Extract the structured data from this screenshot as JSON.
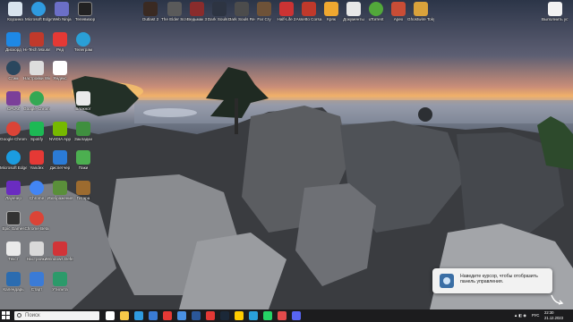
{
  "desktop": {
    "top_row": [
      {
        "label": "Корзина",
        "icon": "recycle-bin-icon",
        "color": "#d9e4ee"
      },
      {
        "label": "Microsoft Edge",
        "icon": "edge-icon",
        "color": "#2f9be0"
      },
      {
        "label": "Web Ninja",
        "icon": "app-icon",
        "color": "#6b6fc7"
      },
      {
        "label": "Телевизор",
        "icon": "tv-icon",
        "color": "#222222"
      }
    ],
    "games_row": [
      {
        "label": "Outlast 2",
        "icon": "game-icon",
        "color": "#3a2a22"
      },
      {
        "label": "The Elder Scrolls",
        "icon": "game-icon",
        "color": "#5a5a5a"
      },
      {
        "label": "Ведьмак 3",
        "icon": "game-icon",
        "color": "#8a2c2c"
      },
      {
        "label": "Dark Souls 3",
        "icon": "game-icon",
        "color": "#2d3442"
      },
      {
        "label": "Dark Souls Remaster",
        "icon": "game-icon",
        "color": "#4c4c4c"
      },
      {
        "label": "Far Cry",
        "icon": "game-icon",
        "color": "#6e5238"
      },
      {
        "label": "Half-Life 2",
        "icon": "game-icon",
        "color": "#cc3333"
      },
      {
        "label": "Assetto Corsa",
        "icon": "game-icon",
        "color": "#c0392b"
      },
      {
        "label": "Кряк",
        "icon": "app-icon",
        "color": "#f0a830"
      },
      {
        "label": "Документы",
        "icon": "document-icon",
        "color": "#e8e8e8"
      },
      {
        "label": "uTorrent",
        "icon": "torrent-icon",
        "color": "#52a83a"
      },
      {
        "label": "Apex",
        "icon": "game-icon",
        "color": "#c94d36"
      },
      {
        "label": "Ghostwire Tokyo",
        "icon": "game-icon",
        "color": "#d9a23b"
      }
    ],
    "right_icon": {
      "label": "Выполнить установку",
      "icon": "document-icon",
      "color": "#f2f2f2"
    },
    "left_column": [
      {
        "label": "Дискорд",
        "icon": "app-icon",
        "color": "#1e88e5"
      },
      {
        "label": "Стим",
        "icon": "steam-icon",
        "color": "#2a475e"
      },
      {
        "label": "CPU-Z",
        "icon": "app-icon",
        "color": "#7b3f99"
      },
      {
        "label": "Google Chrome",
        "icon": "chrome-icon",
        "color": "#db4437"
      },
      {
        "label": "Microsoft Edge",
        "icon": "edge-icon",
        "color": "#1b9ce0"
      },
      {
        "label": "Лаунчер",
        "icon": "app-icon",
        "color": "#6a2cc0"
      },
      {
        "label": "Epic Games",
        "icon": "game-icon",
        "color": "#333333"
      },
      {
        "label": "Текст",
        "icon": "document-icon",
        "color": "#eaeaea"
      },
      {
        "label": "Календарь",
        "icon": "app-icon",
        "color": "#2b6cb0"
      },
      {
        "label": "Телеграм",
        "icon": "app-icon",
        "color": "#2a9fd6"
      }
    ],
    "left_column_2": [
      {
        "label": "Hi-Tech Mouse",
        "icon": "app-icon",
        "color": "#c0392b"
      },
      {
        "label": "Настройки Windows",
        "icon": "gear-icon",
        "color": "#dddddd"
      },
      {
        "label": "Google Chrome",
        "icon": "chrome-icon",
        "color": "#34a853"
      },
      {
        "label": "Spotify",
        "icon": "app-icon",
        "color": "#1db954"
      },
      {
        "label": "Yandex",
        "icon": "app-icon",
        "color": "#e53935"
      },
      {
        "label": "Chrome",
        "icon": "chrome-icon",
        "color": "#4285f4"
      },
      {
        "label": "Chrome Beta",
        "icon": "chrome-icon",
        "color": "#db4437"
      },
      {
        "label": "Настройки",
        "icon": "app-icon",
        "color": "#d9d9d9"
      },
      {
        "label": "Старт",
        "icon": "app-icon",
        "color": "#3b7bd6"
      },
      {
        "label": "Гитара",
        "icon": "app-icon",
        "color": "#9c6b2f"
      }
    ],
    "left_column_3": [
      {
        "label": "Яндекс",
        "icon": "yandex-icon",
        "color": "#ffffff"
      },
      {
        "label": "Ред",
        "icon": "app-icon",
        "color": "#e53935"
      },
      {
        "label": "NVIDIA App",
        "icon": "nvidia-icon",
        "color": "#76b900"
      },
      {
        "label": "Диспетчер",
        "icon": "app-icon",
        "color": "#2b7bd6"
      },
      {
        "label": "Изображения",
        "icon": "image-icon",
        "color": "#5a8f3a"
      },
      {
        "label": "Windows Defender",
        "icon": "app-icon",
        "color": "#d13438"
      },
      {
        "label": "Утилита",
        "icon": "app-icon",
        "color": "#2c9a6a"
      },
      {
        "label": "Блокнот",
        "icon": "document-icon",
        "color": "#eaeaea"
      },
      {
        "label": "Закладки",
        "icon": "app-icon",
        "color": "#3f8f3f"
      },
      {
        "label": "Паки",
        "icon": "app-icon",
        "color": "#4caf50"
      }
    ]
  },
  "toast": {
    "text": "Наведите курсор, чтобы отобразить панель управления."
  },
  "taskbar": {
    "search_placeholder": "Поиск",
    "apps": [
      {
        "name": "task-view",
        "color": "#ffffff"
      },
      {
        "name": "explorer",
        "color": "#f7c948"
      },
      {
        "name": "edge",
        "color": "#2f9be0"
      },
      {
        "name": "store",
        "color": "#3a7bd5"
      },
      {
        "name": "chrome",
        "color": "#e53935"
      },
      {
        "name": "mail",
        "color": "#4a90e2"
      },
      {
        "name": "word",
        "color": "#2b579a"
      },
      {
        "name": "opera",
        "color": "#e53935"
      },
      {
        "name": "steam",
        "color": "#1b2838"
      },
      {
        "name": "yandex",
        "color": "#ffcc00"
      },
      {
        "name": "telegram",
        "color": "#2aa0da"
      },
      {
        "name": "whatsapp",
        "color": "#25d366"
      },
      {
        "name": "photos",
        "color": "#e24b4b"
      },
      {
        "name": "discord",
        "color": "#5865f2"
      }
    ],
    "tray": {
      "lang": "РУС",
      "time": "22:30",
      "date": "21.12.2023"
    }
  }
}
